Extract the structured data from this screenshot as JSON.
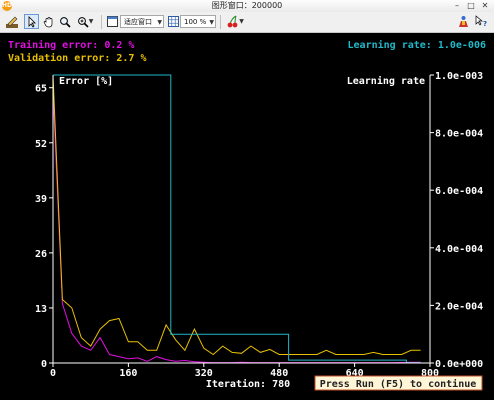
{
  "window": {
    "title": "图形窗口：200000",
    "app_icon_label": "HD"
  },
  "toolbar": {
    "zoom_fit_label": "适应窗口",
    "zoom_percent_label": "100 %"
  },
  "status": {
    "training_error": "Training error: 0.2 %",
    "validation_error": "Validation error: 2.7 %",
    "learning_rate": "Learning rate: 1.0e-006",
    "iteration": "Iteration: 780",
    "press_run": "Press Run (F5) to continue"
  },
  "colors": {
    "training": "#e010e0",
    "validation": "#e8c000",
    "learning_rate": "#20b8c8",
    "axis": "#ffffff",
    "background": "#000000"
  },
  "chart_data": {
    "type": "line",
    "left_axis_title": "Error [%]",
    "right_axis_title": "Learning rate",
    "x_ticks": [
      "0",
      "160",
      "320",
      "480",
      "640",
      "800"
    ],
    "left_ticks": [
      "0",
      "13",
      "26",
      "39",
      "52",
      "65"
    ],
    "right_ticks": [
      "0.0e+000",
      "2.0e-004",
      "4.0e-004",
      "6.0e-004",
      "8.0e-004",
      "1.0e-003"
    ],
    "xlim": [
      0,
      800
    ],
    "ylim_left": [
      0,
      68
    ],
    "ylim_right": [
      0,
      0.001
    ],
    "series": [
      {
        "name": "Training error",
        "axis": "left",
        "x": [
          0,
          20,
          40,
          60,
          80,
          100,
          120,
          140,
          160,
          180,
          200,
          220,
          240,
          260,
          280,
          300,
          320,
          340,
          360,
          380,
          400,
          420,
          440,
          460,
          480,
          520,
          560,
          600,
          640,
          680,
          720,
          760,
          780
        ],
        "y": [
          64,
          14,
          7,
          4,
          3,
          6,
          2,
          1.5,
          1,
          1.2,
          0.4,
          1.5,
          0.8,
          0.4,
          0.6,
          0.3,
          0.2,
          0.1,
          0.1,
          0.1,
          0.2,
          0.1,
          0.1,
          0.1,
          0.1,
          0.1,
          0.1,
          0.1,
          0.1,
          0.1,
          0.1,
          0.2,
          0.2
        ]
      },
      {
        "name": "Validation error",
        "axis": "left",
        "x": [
          0,
          20,
          40,
          60,
          80,
          100,
          120,
          140,
          160,
          180,
          200,
          220,
          240,
          260,
          280,
          300,
          320,
          340,
          360,
          380,
          400,
          420,
          440,
          460,
          480,
          500,
          520,
          540,
          560,
          580,
          600,
          620,
          640,
          660,
          680,
          700,
          720,
          740,
          760,
          780
        ],
        "y": [
          68,
          15,
          13,
          6,
          4,
          8,
          10,
          10.5,
          5,
          5,
          3,
          3,
          9,
          5.5,
          3,
          8,
          3.5,
          2,
          4,
          2.5,
          2.3,
          4,
          2.5,
          3.2,
          2,
          2,
          2,
          2,
          2,
          3,
          2,
          2,
          2,
          2,
          2.5,
          2,
          2,
          2,
          3,
          3
        ]
      },
      {
        "name": "Learning rate",
        "axis": "right",
        "x": [
          0,
          250,
          250,
          500,
          500,
          750,
          750,
          780
        ],
        "y": [
          0.001,
          0.001,
          0.0001,
          0.0001,
          1e-05,
          1e-05,
          1e-06,
          1e-06
        ]
      }
    ]
  }
}
